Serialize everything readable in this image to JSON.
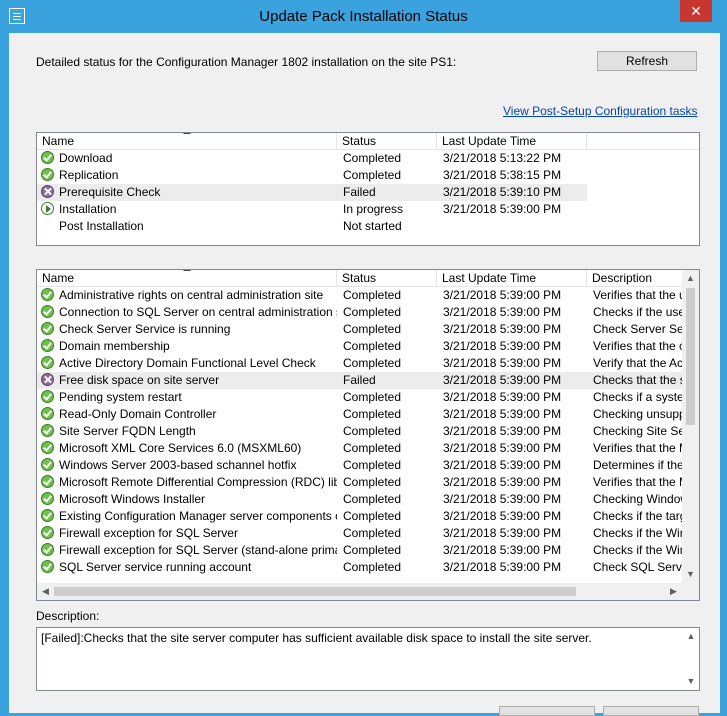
{
  "window": {
    "title": "Update Pack Installation Status",
    "close_label": "✕"
  },
  "intro_text": "Detailed status for the Configuration Manager 1802 installation on the site PS1:",
  "refresh_label": "Refresh",
  "link_text": "View Post-Setup Configuration tasks",
  "summary": {
    "columns": [
      "Name",
      "Status",
      "Last Update Time"
    ],
    "rows": [
      {
        "icon": "ok",
        "name": "Download",
        "status": "Completed",
        "time": "3/21/2018 5:13:22 PM"
      },
      {
        "icon": "ok",
        "name": "Replication",
        "status": "Completed",
        "time": "3/21/2018 5:38:15 PM"
      },
      {
        "icon": "fail",
        "name": "Prerequisite Check",
        "status": "Failed",
        "time": "3/21/2018 5:39:10 PM",
        "selected": true
      },
      {
        "icon": "prog",
        "name": "Installation",
        "status": "In progress",
        "time": "3/21/2018 5:39:00 PM"
      },
      {
        "icon": "none",
        "name": "Post Installation",
        "status": "Not started",
        "time": ""
      }
    ]
  },
  "details": {
    "columns": [
      "Name",
      "Status",
      "Last Update Time",
      "Description"
    ],
    "rows": [
      {
        "icon": "ok",
        "name": "Administrative rights on central administration site",
        "status": "Completed",
        "time": "3/21/2018 5:39:00 PM",
        "desc": "Verifies that the us"
      },
      {
        "icon": "ok",
        "name": "Connection to SQL Server on central administration site",
        "status": "Completed",
        "time": "3/21/2018 5:39:00 PM",
        "desc": "Checks if the user"
      },
      {
        "icon": "ok",
        "name": "Check Server Service is running",
        "status": "Completed",
        "time": "3/21/2018 5:39:00 PM",
        "desc": "Check Server Serv"
      },
      {
        "icon": "ok",
        "name": "Domain membership",
        "status": "Completed",
        "time": "3/21/2018 5:39:00 PM",
        "desc": "Verifies that the co"
      },
      {
        "icon": "ok",
        "name": "Active Directory Domain Functional Level Check",
        "status": "Completed",
        "time": "3/21/2018 5:39:00 PM",
        "desc": "Verify that the Acti"
      },
      {
        "icon": "fail",
        "name": "Free disk space on site server",
        "status": "Failed",
        "time": "3/21/2018 5:39:00 PM",
        "desc": "Checks that the sit",
        "selected": true
      },
      {
        "icon": "ok",
        "name": "Pending system restart",
        "status": "Completed",
        "time": "3/21/2018 5:39:00 PM",
        "desc": "Checks if a system"
      },
      {
        "icon": "ok",
        "name": "Read-Only Domain Controller",
        "status": "Completed",
        "time": "3/21/2018 5:39:00 PM",
        "desc": "Checking unsuppo"
      },
      {
        "icon": "ok",
        "name": "Site Server FQDN Length",
        "status": "Completed",
        "time": "3/21/2018 5:39:00 PM",
        "desc": "Checking Site Ser"
      },
      {
        "icon": "ok",
        "name": "Microsoft XML Core Services 6.0 (MSXML60)",
        "status": "Completed",
        "time": "3/21/2018 5:39:00 PM",
        "desc": "Verifies that the Mi"
      },
      {
        "icon": "ok",
        "name": "Windows Server 2003-based schannel hotfix",
        "status": "Completed",
        "time": "3/21/2018 5:39:00 PM",
        "desc": "Determines if the W"
      },
      {
        "icon": "ok",
        "name": "Microsoft Remote Differential Compression (RDC) library r...",
        "status": "Completed",
        "time": "3/21/2018 5:39:00 PM",
        "desc": "Verifies that the Mi"
      },
      {
        "icon": "ok",
        "name": "Microsoft Windows Installer",
        "status": "Completed",
        "time": "3/21/2018 5:39:00 PM",
        "desc": "Checking Window"
      },
      {
        "icon": "ok",
        "name": "Existing Configuration Manager server components on sit...",
        "status": "Completed",
        "time": "3/21/2018 5:39:00 PM",
        "desc": "Checks if the targe"
      },
      {
        "icon": "ok",
        "name": "Firewall exception for SQL Server",
        "status": "Completed",
        "time": "3/21/2018 5:39:00 PM",
        "desc": "Checks if the Wind"
      },
      {
        "icon": "ok",
        "name": "Firewall exception for SQL Server (stand-alone primary site)",
        "status": "Completed",
        "time": "3/21/2018 5:39:00 PM",
        "desc": "Checks if the Wind"
      },
      {
        "icon": "ok",
        "name": "SQL Server service running account",
        "status": "Completed",
        "time": "3/21/2018 5:39:00 PM",
        "desc": "Check SQL Server"
      }
    ]
  },
  "description": {
    "label": "Description:",
    "text": "[Failed]:Checks that the site server computer has sufficient available disk space to install the site server."
  }
}
